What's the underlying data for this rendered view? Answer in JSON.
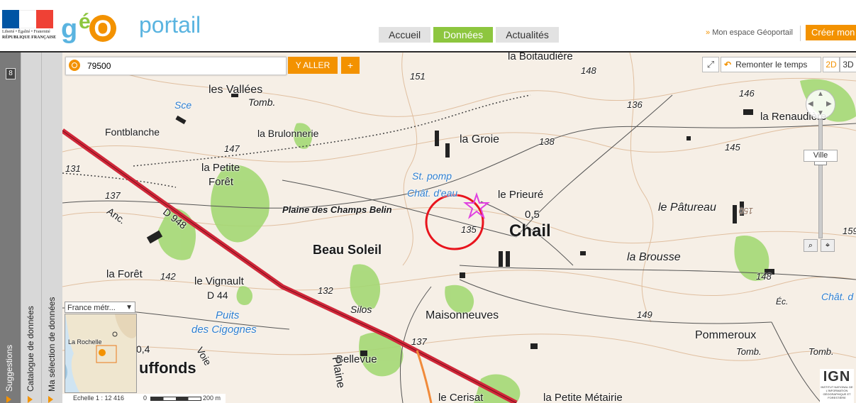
{
  "header": {
    "rf_logo": {
      "line1": "Liberté • Égalité • Fraternité",
      "line2": "RÉPUBLIQUE FRANÇAISE",
      "flag_colors": [
        "#0055a4",
        "#ffffff",
        "#ef4135"
      ]
    },
    "brand": {
      "g": "g",
      "e": "é",
      "o": "O",
      "portail": "portail"
    },
    "nav": [
      {
        "label": "Accueil",
        "active": false
      },
      {
        "label": "Données",
        "active": true
      },
      {
        "label": "Actualités",
        "active": false
      }
    ],
    "space_link": "Mon espace Géoportail",
    "create_button": "Créer mon e"
  },
  "sidebar": {
    "badge": "8",
    "tabs": [
      {
        "label": "Suggestions"
      },
      {
        "label": "Catalogue de données"
      },
      {
        "label": "Ma sélection de données"
      }
    ]
  },
  "search": {
    "value": "79500",
    "go_label": "Y ALLER",
    "plus_label": "+"
  },
  "controls": {
    "time_label": "Remonter le temps",
    "view_2d": "2D",
    "view_3d": "3D",
    "zoom_level_label": "Ville"
  },
  "overview": {
    "select_value": "France métr...",
    "city_label": "La Rochelle"
  },
  "scale": {
    "label": "Echelle 1 : 12 416",
    "min": "0",
    "max": "200 m"
  },
  "ign": {
    "title": "IGN",
    "subtitle": "INSTITUT NATIONAL DE L'INFORMATION GÉOGRAPHIQUE ET FORESTIÈRE"
  },
  "map": {
    "colors": {
      "forest": "#9fd66e",
      "road": "#d0283a",
      "highlight_circle": "#e8141d",
      "water": "#2e7fd0"
    },
    "labels": [
      {
        "text": "les Vallées"
      },
      {
        "text": "Tomb."
      },
      {
        "text": "Sce"
      },
      {
        "text": "Fontblanche"
      },
      {
        "text": "la Brulonnerie"
      },
      {
        "text": "147"
      },
      {
        "text": "131"
      },
      {
        "text": "la Petite"
      },
      {
        "text": "Forêt"
      },
      {
        "text": "137"
      },
      {
        "text": "Anc."
      },
      {
        "text": "D 948"
      },
      {
        "text": "Plaine des Champs Belin"
      },
      {
        "text": "Beau Soleil"
      },
      {
        "text": "la Forêt"
      },
      {
        "text": "142"
      },
      {
        "text": "le Vignault"
      },
      {
        "text": "D 44"
      },
      {
        "text": "132"
      },
      {
        "text": "Puits"
      },
      {
        "text": "des Cigognes"
      },
      {
        "text": "Silos"
      },
      {
        "text": "Maisonneuves"
      },
      {
        "text": "137"
      },
      {
        "text": "Bellevue"
      },
      {
        "text": "Plaine"
      },
      {
        "text": "Voie"
      },
      {
        "text": "uffonds"
      },
      {
        "text": "0,4"
      },
      {
        "text": "le Cerisat"
      },
      {
        "text": "la Petite Métairie"
      },
      {
        "text": "151"
      },
      {
        "text": "la Boitaudière"
      },
      {
        "text": "148"
      },
      {
        "text": "la Groie"
      },
      {
        "text": "138"
      },
      {
        "text": "St. pomp"
      },
      {
        "text": "Chât. d'eau"
      },
      {
        "text": "le Prieuré"
      },
      {
        "text": "0,5"
      },
      {
        "text": "Chail"
      },
      {
        "text": "135"
      },
      {
        "text": "136"
      },
      {
        "text": "146"
      },
      {
        "text": "la Renaudière"
      },
      {
        "text": "145"
      },
      {
        "text": "le Pâtureau"
      },
      {
        "text": "la Brousse"
      },
      {
        "text": "150"
      },
      {
        "text": "148"
      },
      {
        "text": "149"
      },
      {
        "text": "Pommeroux"
      },
      {
        "text": "Tomb."
      },
      {
        "text": "Tomb."
      },
      {
        "text": "Chât. d"
      },
      {
        "text": "Éc."
      },
      {
        "text": "159"
      }
    ]
  }
}
